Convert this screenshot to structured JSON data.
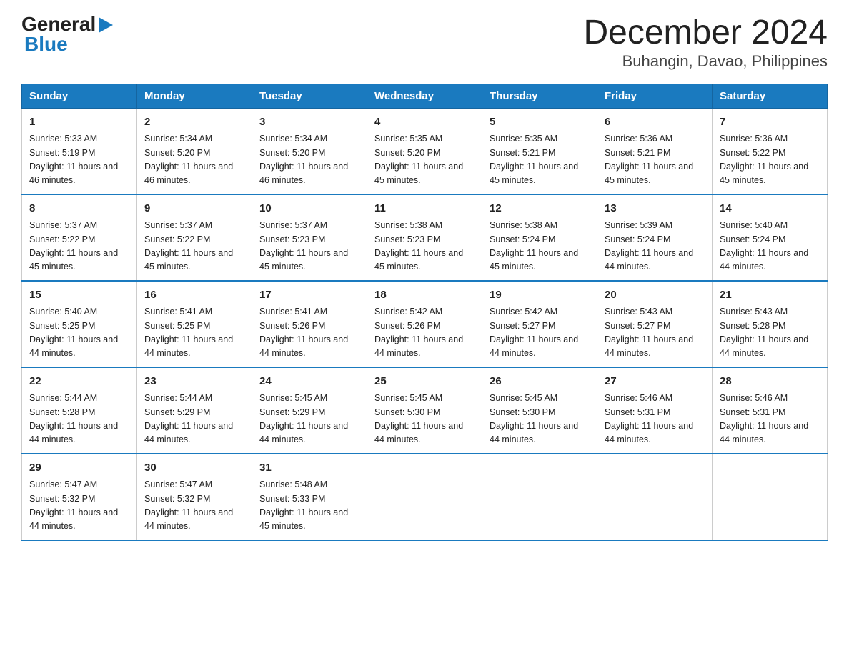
{
  "logo": {
    "general": "General",
    "blue": "Blue",
    "arrow": "▶"
  },
  "title": "December 2024",
  "subtitle": "Buhangin, Davao, Philippines",
  "weekdays": [
    "Sunday",
    "Monday",
    "Tuesday",
    "Wednesday",
    "Thursday",
    "Friday",
    "Saturday"
  ],
  "weeks": [
    [
      {
        "day": "1",
        "sunrise": "5:33 AM",
        "sunset": "5:19 PM",
        "daylight": "11 hours and 46 minutes."
      },
      {
        "day": "2",
        "sunrise": "5:34 AM",
        "sunset": "5:20 PM",
        "daylight": "11 hours and 46 minutes."
      },
      {
        "day": "3",
        "sunrise": "5:34 AM",
        "sunset": "5:20 PM",
        "daylight": "11 hours and 46 minutes."
      },
      {
        "day": "4",
        "sunrise": "5:35 AM",
        "sunset": "5:20 PM",
        "daylight": "11 hours and 45 minutes."
      },
      {
        "day": "5",
        "sunrise": "5:35 AM",
        "sunset": "5:21 PM",
        "daylight": "11 hours and 45 minutes."
      },
      {
        "day": "6",
        "sunrise": "5:36 AM",
        "sunset": "5:21 PM",
        "daylight": "11 hours and 45 minutes."
      },
      {
        "day": "7",
        "sunrise": "5:36 AM",
        "sunset": "5:22 PM",
        "daylight": "11 hours and 45 minutes."
      }
    ],
    [
      {
        "day": "8",
        "sunrise": "5:37 AM",
        "sunset": "5:22 PM",
        "daylight": "11 hours and 45 minutes."
      },
      {
        "day": "9",
        "sunrise": "5:37 AM",
        "sunset": "5:22 PM",
        "daylight": "11 hours and 45 minutes."
      },
      {
        "day": "10",
        "sunrise": "5:37 AM",
        "sunset": "5:23 PM",
        "daylight": "11 hours and 45 minutes."
      },
      {
        "day": "11",
        "sunrise": "5:38 AM",
        "sunset": "5:23 PM",
        "daylight": "11 hours and 45 minutes."
      },
      {
        "day": "12",
        "sunrise": "5:38 AM",
        "sunset": "5:24 PM",
        "daylight": "11 hours and 45 minutes."
      },
      {
        "day": "13",
        "sunrise": "5:39 AM",
        "sunset": "5:24 PM",
        "daylight": "11 hours and 44 minutes."
      },
      {
        "day": "14",
        "sunrise": "5:40 AM",
        "sunset": "5:24 PM",
        "daylight": "11 hours and 44 minutes."
      }
    ],
    [
      {
        "day": "15",
        "sunrise": "5:40 AM",
        "sunset": "5:25 PM",
        "daylight": "11 hours and 44 minutes."
      },
      {
        "day": "16",
        "sunrise": "5:41 AM",
        "sunset": "5:25 PM",
        "daylight": "11 hours and 44 minutes."
      },
      {
        "day": "17",
        "sunrise": "5:41 AM",
        "sunset": "5:26 PM",
        "daylight": "11 hours and 44 minutes."
      },
      {
        "day": "18",
        "sunrise": "5:42 AM",
        "sunset": "5:26 PM",
        "daylight": "11 hours and 44 minutes."
      },
      {
        "day": "19",
        "sunrise": "5:42 AM",
        "sunset": "5:27 PM",
        "daylight": "11 hours and 44 minutes."
      },
      {
        "day": "20",
        "sunrise": "5:43 AM",
        "sunset": "5:27 PM",
        "daylight": "11 hours and 44 minutes."
      },
      {
        "day": "21",
        "sunrise": "5:43 AM",
        "sunset": "5:28 PM",
        "daylight": "11 hours and 44 minutes."
      }
    ],
    [
      {
        "day": "22",
        "sunrise": "5:44 AM",
        "sunset": "5:28 PM",
        "daylight": "11 hours and 44 minutes."
      },
      {
        "day": "23",
        "sunrise": "5:44 AM",
        "sunset": "5:29 PM",
        "daylight": "11 hours and 44 minutes."
      },
      {
        "day": "24",
        "sunrise": "5:45 AM",
        "sunset": "5:29 PM",
        "daylight": "11 hours and 44 minutes."
      },
      {
        "day": "25",
        "sunrise": "5:45 AM",
        "sunset": "5:30 PM",
        "daylight": "11 hours and 44 minutes."
      },
      {
        "day": "26",
        "sunrise": "5:45 AM",
        "sunset": "5:30 PM",
        "daylight": "11 hours and 44 minutes."
      },
      {
        "day": "27",
        "sunrise": "5:46 AM",
        "sunset": "5:31 PM",
        "daylight": "11 hours and 44 minutes."
      },
      {
        "day": "28",
        "sunrise": "5:46 AM",
        "sunset": "5:31 PM",
        "daylight": "11 hours and 44 minutes."
      }
    ],
    [
      {
        "day": "29",
        "sunrise": "5:47 AM",
        "sunset": "5:32 PM",
        "daylight": "11 hours and 44 minutes."
      },
      {
        "day": "30",
        "sunrise": "5:47 AM",
        "sunset": "5:32 PM",
        "daylight": "11 hours and 44 minutes."
      },
      {
        "day": "31",
        "sunrise": "5:48 AM",
        "sunset": "5:33 PM",
        "daylight": "11 hours and 45 minutes."
      },
      null,
      null,
      null,
      null
    ]
  ]
}
